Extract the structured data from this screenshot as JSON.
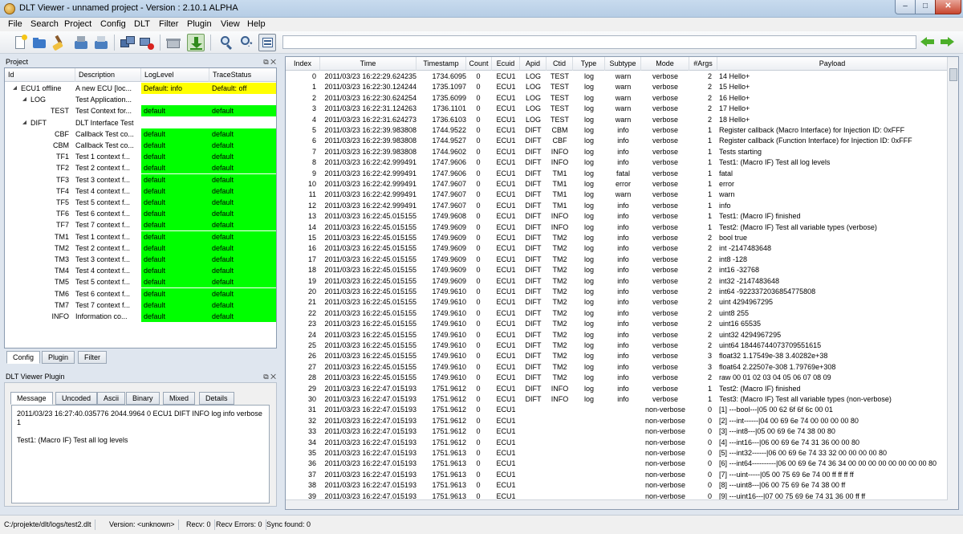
{
  "window": {
    "title": "DLT Viewer - unnamed project - Version : 2.10.1 ALPHA"
  },
  "menu": [
    "File",
    "Search",
    "Project",
    "Config",
    "DLT",
    "Filter",
    "Plugin",
    "View",
    "Help"
  ],
  "toolbar": {
    "search_value": ""
  },
  "project_panel": {
    "title": "Project",
    "headers": [
      "Id",
      "Description",
      "LogLevel",
      "TraceStatus"
    ],
    "rows": [
      {
        "id": "ECU1 offline",
        "desc": "A new ECU [loc...",
        "loglevel": "Default: info",
        "trace": "Default: off",
        "level": 0,
        "color": "yellow"
      },
      {
        "id": "LOG",
        "desc": "Test Application...",
        "loglevel": "",
        "trace": "",
        "level": 1,
        "color": "none"
      },
      {
        "id": "TEST",
        "desc": "Test Context for...",
        "loglevel": "default",
        "trace": "default",
        "level": 2,
        "color": "green"
      },
      {
        "id": "DIFT",
        "desc": "DLT Interface Test",
        "loglevel": "",
        "trace": "",
        "level": 1,
        "color": "none"
      },
      {
        "id": "CBF",
        "desc": "Callback Test co...",
        "loglevel": "default",
        "trace": "default",
        "level": 2,
        "color": "green"
      },
      {
        "id": "CBM",
        "desc": "Callback Test co...",
        "loglevel": "default",
        "trace": "default",
        "level": 2,
        "color": "green"
      },
      {
        "id": "TF1",
        "desc": "Test 1 context f...",
        "loglevel": "default",
        "trace": "default",
        "level": 2,
        "color": "green"
      },
      {
        "id": "TF2",
        "desc": "Test 2 context f...",
        "loglevel": "default",
        "trace": "default",
        "level": 2,
        "color": "green"
      },
      {
        "id": "TF3",
        "desc": "Test 3 context f...",
        "loglevel": "default",
        "trace": "default",
        "level": 2,
        "color": "green"
      },
      {
        "id": "TF4",
        "desc": "Test 4 context f...",
        "loglevel": "default",
        "trace": "default",
        "level": 2,
        "color": "green"
      },
      {
        "id": "TF5",
        "desc": "Test 5 context f...",
        "loglevel": "default",
        "trace": "default",
        "level": 2,
        "color": "green"
      },
      {
        "id": "TF6",
        "desc": "Test 6 context f...",
        "loglevel": "default",
        "trace": "default",
        "level": 2,
        "color": "green"
      },
      {
        "id": "TF7",
        "desc": "Test 7 context f...",
        "loglevel": "default",
        "trace": "default",
        "level": 2,
        "color": "green"
      },
      {
        "id": "TM1",
        "desc": "Test 1 context f...",
        "loglevel": "default",
        "trace": "default",
        "level": 2,
        "color": "green"
      },
      {
        "id": "TM2",
        "desc": "Test 2 context f...",
        "loglevel": "default",
        "trace": "default",
        "level": 2,
        "color": "green"
      },
      {
        "id": "TM3",
        "desc": "Test 3 context f...",
        "loglevel": "default",
        "trace": "default",
        "level": 2,
        "color": "green"
      },
      {
        "id": "TM4",
        "desc": "Test 4 context f...",
        "loglevel": "default",
        "trace": "default",
        "level": 2,
        "color": "green"
      },
      {
        "id": "TM5",
        "desc": "Test 5 context f...",
        "loglevel": "default",
        "trace": "default",
        "level": 2,
        "color": "green"
      },
      {
        "id": "TM6",
        "desc": "Test 6 context f...",
        "loglevel": "default",
        "trace": "default",
        "level": 2,
        "color": "green"
      },
      {
        "id": "TM7",
        "desc": "Test 7 context f...",
        "loglevel": "default",
        "trace": "default",
        "level": 2,
        "color": "green"
      },
      {
        "id": "INFO",
        "desc": "Information co...",
        "loglevel": "default",
        "trace": "default",
        "level": 2,
        "color": "green"
      }
    ],
    "tabs": [
      "Config",
      "Plugin",
      "Filter"
    ]
  },
  "plugin_panel": {
    "title": "DLT Viewer Plugin",
    "tabs": [
      "Message",
      "Uncoded",
      "Ascii",
      "Binary",
      "Mixed",
      "Details"
    ],
    "message_line1": "2011/03/23 16:27:40.035776 2044.9964 0 ECU1 DIFT INFO log info verbose",
    "message_line2": "1",
    "message_line3": "Test1: (Macro IF) Test all log levels"
  },
  "table": {
    "headers": [
      "Index",
      "Time",
      "Timestamp",
      "Count",
      "Ecuid",
      "Apid",
      "Ctid",
      "Type",
      "Subtype",
      "Mode",
      "#Args",
      "Payload"
    ],
    "rows": [
      [
        "0",
        "2011/03/23 16:22:29.624235",
        "1734.6095",
        "0",
        "ECU1",
        "LOG",
        "TEST",
        "log",
        "warn",
        "verbose",
        "2",
        "14 Hello+"
      ],
      [
        "1",
        "2011/03/23 16:22:30.124244",
        "1735.1097",
        "0",
        "ECU1",
        "LOG",
        "TEST",
        "log",
        "warn",
        "verbose",
        "2",
        "15 Hello+"
      ],
      [
        "2",
        "2011/03/23 16:22:30.624254",
        "1735.6099",
        "0",
        "ECU1",
        "LOG",
        "TEST",
        "log",
        "warn",
        "verbose",
        "2",
        "16 Hello+"
      ],
      [
        "3",
        "2011/03/23 16:22:31.124263",
        "1736.1101",
        "0",
        "ECU1",
        "LOG",
        "TEST",
        "log",
        "warn",
        "verbose",
        "2",
        "17 Hello+"
      ],
      [
        "4",
        "2011/03/23 16:22:31.624273",
        "1736.6103",
        "0",
        "ECU1",
        "LOG",
        "TEST",
        "log",
        "warn",
        "verbose",
        "2",
        "18 Hello+"
      ],
      [
        "5",
        "2011/03/23 16:22:39.983808",
        "1744.9522",
        "0",
        "ECU1",
        "DIFT",
        "CBM",
        "log",
        "info",
        "verbose",
        "1",
        "Register callback (Macro Interface) for Injection ID: 0xFFF"
      ],
      [
        "6",
        "2011/03/23 16:22:39.983808",
        "1744.9527",
        "0",
        "ECU1",
        "DIFT",
        "CBF",
        "log",
        "info",
        "verbose",
        "1",
        "Register callback (Function Interface) for Injection ID: 0xFFF"
      ],
      [
        "7",
        "2011/03/23 16:22:39.983808",
        "1744.9602",
        "0",
        "ECU1",
        "DIFT",
        "INFO",
        "log",
        "info",
        "verbose",
        "1",
        "Tests starting"
      ],
      [
        "8",
        "2011/03/23 16:22:42.999491",
        "1747.9606",
        "0",
        "ECU1",
        "DIFT",
        "INFO",
        "log",
        "info",
        "verbose",
        "1",
        "Test1: (Macro IF) Test all log levels"
      ],
      [
        "9",
        "2011/03/23 16:22:42.999491",
        "1747.9606",
        "0",
        "ECU1",
        "DIFT",
        "TM1",
        "log",
        "fatal",
        "verbose",
        "1",
        "fatal"
      ],
      [
        "10",
        "2011/03/23 16:22:42.999491",
        "1747.9607",
        "0",
        "ECU1",
        "DIFT",
        "TM1",
        "log",
        "error",
        "verbose",
        "1",
        "error"
      ],
      [
        "11",
        "2011/03/23 16:22:42.999491",
        "1747.9607",
        "0",
        "ECU1",
        "DIFT",
        "TM1",
        "log",
        "warn",
        "verbose",
        "1",
        "warn"
      ],
      [
        "12",
        "2011/03/23 16:22:42.999491",
        "1747.9607",
        "0",
        "ECU1",
        "DIFT",
        "TM1",
        "log",
        "info",
        "verbose",
        "1",
        "info"
      ],
      [
        "13",
        "2011/03/23 16:22:45.015155",
        "1749.9608",
        "0",
        "ECU1",
        "DIFT",
        "INFO",
        "log",
        "info",
        "verbose",
        "1",
        "Test1: (Macro IF) finished"
      ],
      [
        "14",
        "2011/03/23 16:22:45.015155",
        "1749.9609",
        "0",
        "ECU1",
        "DIFT",
        "INFO",
        "log",
        "info",
        "verbose",
        "1",
        "Test2: (Macro IF) Test all variable types (verbose)"
      ],
      [
        "15",
        "2011/03/23 16:22:45.015155",
        "1749.9609",
        "0",
        "ECU1",
        "DIFT",
        "TM2",
        "log",
        "info",
        "verbose",
        "2",
        "bool true"
      ],
      [
        "16",
        "2011/03/23 16:22:45.015155",
        "1749.9609",
        "0",
        "ECU1",
        "DIFT",
        "TM2",
        "log",
        "info",
        "verbose",
        "2",
        "int -2147483648"
      ],
      [
        "17",
        "2011/03/23 16:22:45.015155",
        "1749.9609",
        "0",
        "ECU1",
        "DIFT",
        "TM2",
        "log",
        "info",
        "verbose",
        "2",
        "int8 -128"
      ],
      [
        "18",
        "2011/03/23 16:22:45.015155",
        "1749.9609",
        "0",
        "ECU1",
        "DIFT",
        "TM2",
        "log",
        "info",
        "verbose",
        "2",
        "int16 -32768"
      ],
      [
        "19",
        "2011/03/23 16:22:45.015155",
        "1749.9609",
        "0",
        "ECU1",
        "DIFT",
        "TM2",
        "log",
        "info",
        "verbose",
        "2",
        "int32 -2147483648"
      ],
      [
        "20",
        "2011/03/23 16:22:45.015155",
        "1749.9610",
        "0",
        "ECU1",
        "DIFT",
        "TM2",
        "log",
        "info",
        "verbose",
        "2",
        "int64 -9223372036854775808"
      ],
      [
        "21",
        "2011/03/23 16:22:45.015155",
        "1749.9610",
        "0",
        "ECU1",
        "DIFT",
        "TM2",
        "log",
        "info",
        "verbose",
        "2",
        "uint 4294967295"
      ],
      [
        "22",
        "2011/03/23 16:22:45.015155",
        "1749.9610",
        "0",
        "ECU1",
        "DIFT",
        "TM2",
        "log",
        "info",
        "verbose",
        "2",
        "uint8 255"
      ],
      [
        "23",
        "2011/03/23 16:22:45.015155",
        "1749.9610",
        "0",
        "ECU1",
        "DIFT",
        "TM2",
        "log",
        "info",
        "verbose",
        "2",
        "uint16 65535"
      ],
      [
        "24",
        "2011/03/23 16:22:45.015155",
        "1749.9610",
        "0",
        "ECU1",
        "DIFT",
        "TM2",
        "log",
        "info",
        "verbose",
        "2",
        "uint32 4294967295"
      ],
      [
        "25",
        "2011/03/23 16:22:45.015155",
        "1749.9610",
        "0",
        "ECU1",
        "DIFT",
        "TM2",
        "log",
        "info",
        "verbose",
        "2",
        "uint64 18446744073709551615"
      ],
      [
        "26",
        "2011/03/23 16:22:45.015155",
        "1749.9610",
        "0",
        "ECU1",
        "DIFT",
        "TM2",
        "log",
        "info",
        "verbose",
        "3",
        "float32 1.17549e-38 3.40282e+38"
      ],
      [
        "27",
        "2011/03/23 16:22:45.015155",
        "1749.9610",
        "0",
        "ECU1",
        "DIFT",
        "TM2",
        "log",
        "info",
        "verbose",
        "3",
        "float64 2.22507e-308 1.79769e+308"
      ],
      [
        "28",
        "2011/03/23 16:22:45.015155",
        "1749.9610",
        "0",
        "ECU1",
        "DIFT",
        "TM2",
        "log",
        "info",
        "verbose",
        "2",
        "raw 00 01 02 03 04 05 06 07 08 09"
      ],
      [
        "29",
        "2011/03/23 16:22:47.015193",
        "1751.9612",
        "0",
        "ECU1",
        "DIFT",
        "INFO",
        "log",
        "info",
        "verbose",
        "1",
        "Test2: (Macro IF) finished"
      ],
      [
        "30",
        "2011/03/23 16:22:47.015193",
        "1751.9612",
        "0",
        "ECU1",
        "DIFT",
        "INFO",
        "log",
        "info",
        "verbose",
        "1",
        "Test3: (Macro IF) Test all variable types (non-verbose)"
      ],
      [
        "31",
        "2011/03/23 16:22:47.015193",
        "1751.9612",
        "0",
        "ECU1",
        "",
        "",
        "",
        "",
        "non-verbose",
        "0",
        "[1] ---bool---|05 00 62 6f 6f 6c 00 01"
      ],
      [
        "32",
        "2011/03/23 16:22:47.015193",
        "1751.9612",
        "0",
        "ECU1",
        "",
        "",
        "",
        "",
        "non-verbose",
        "0",
        "[2] ---int------|04 00 69 6e 74 00 00 00 00 80"
      ],
      [
        "33",
        "2011/03/23 16:22:47.015193",
        "1751.9612",
        "0",
        "ECU1",
        "",
        "",
        "",
        "",
        "non-verbose",
        "0",
        "[3] ---int8---|05 00 69 6e 74 38 00 80"
      ],
      [
        "34",
        "2011/03/23 16:22:47.015193",
        "1751.9612",
        "0",
        "ECU1",
        "",
        "",
        "",
        "",
        "non-verbose",
        "0",
        "[4] ---int16---|06 00 69 6e 74 31 36 00 00 80"
      ],
      [
        "35",
        "2011/03/23 16:22:47.015193",
        "1751.9613",
        "0",
        "ECU1",
        "",
        "",
        "",
        "",
        "non-verbose",
        "0",
        "[5] ---int32------|06 00 69 6e 74 33 32 00 00 00 00 80"
      ],
      [
        "36",
        "2011/03/23 16:22:47.015193",
        "1751.9613",
        "0",
        "ECU1",
        "",
        "",
        "",
        "",
        "non-verbose",
        "0",
        "[6] ---int64----------|06 00 69 6e 74 36 34 00 00 00 00 00 00 00 00 80"
      ],
      [
        "37",
        "2011/03/23 16:22:47.015193",
        "1751.9613",
        "0",
        "ECU1",
        "",
        "",
        "",
        "",
        "non-verbose",
        "0",
        "[7] ---uint-----|05 00 75 69 6e 74 00 ff ff ff ff"
      ],
      [
        "38",
        "2011/03/23 16:22:47.015193",
        "1751.9613",
        "0",
        "ECU1",
        "",
        "",
        "",
        "",
        "non-verbose",
        "0",
        "[8] ---uint8---|06 00 75 69 6e 74 38 00 ff"
      ],
      [
        "39",
        "2011/03/23 16:22:47.015193",
        "1751.9613",
        "0",
        "ECU1",
        "",
        "",
        "",
        "",
        "non-verbose",
        "0",
        "[9] ---uint16---|07 00 75 69 6e 74 31 36 00 ff ff"
      ]
    ]
  },
  "status": {
    "file": "C:/projekte/dlt/logs/test2.dlt",
    "version": "Version: <unknown>",
    "recv": "Recv: 0",
    "recv_errors": "Recv Errors: 0",
    "sync": "Sync found: 0"
  },
  "icons": [
    "new-file-icon",
    "open-folder-icon",
    "clear-icon",
    "save-icon",
    "export-icon",
    "connect-ecu-icon",
    "disconnect-ecu-icon",
    "trash-icon",
    "apply-config-icon",
    "search-icon",
    "regex-search-icon",
    "filter-view-icon",
    "prev-arrow-icon",
    "next-arrow-icon"
  ],
  "colors": {
    "loglevel_default": "#00ff00",
    "ecu_default": "#ffff00",
    "title_bar": "#c8dbee"
  }
}
